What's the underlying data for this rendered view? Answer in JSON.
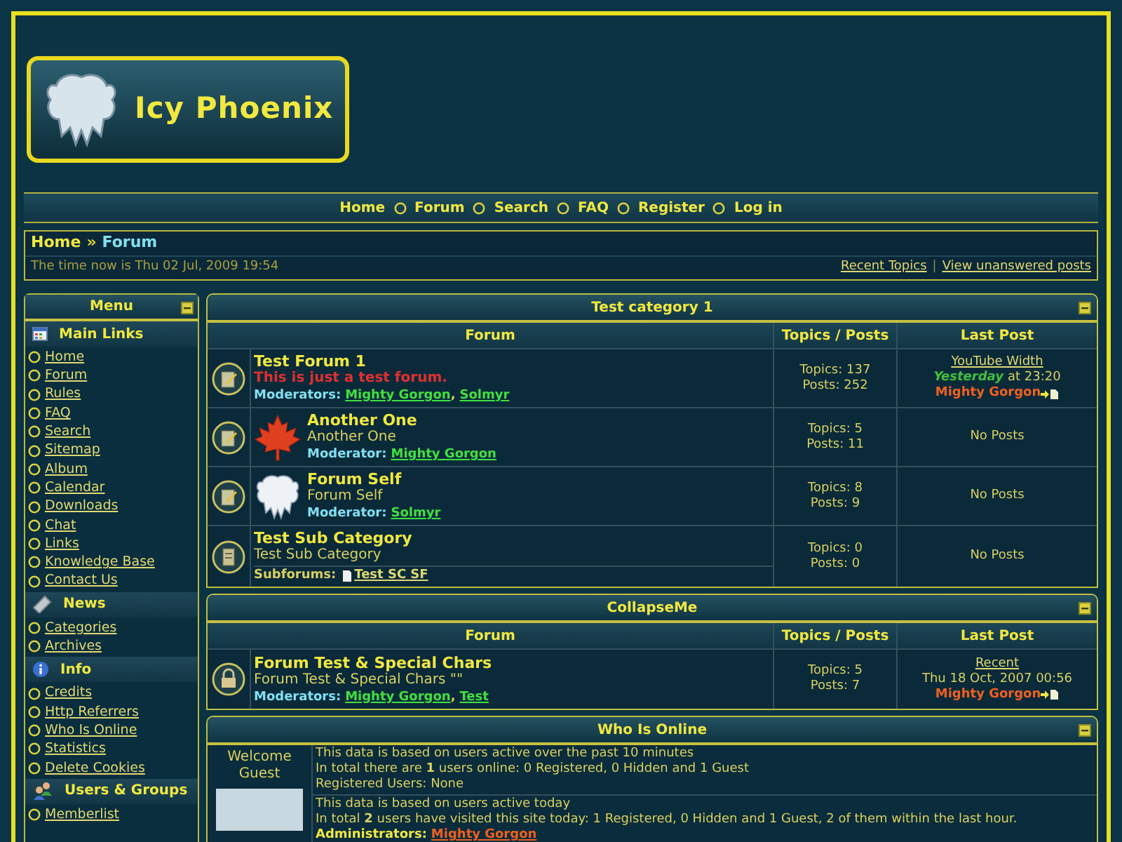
{
  "logo": {
    "text": "Icy Phoenix"
  },
  "nav": [
    {
      "label": "Home"
    },
    {
      "label": "Forum"
    },
    {
      "label": "Search"
    },
    {
      "label": "FAQ"
    },
    {
      "label": "Register"
    },
    {
      "label": "Log in"
    }
  ],
  "breadcrumb": {
    "items": [
      {
        "label": "Home",
        "selected": false
      },
      {
        "label": "Forum",
        "selected": true
      }
    ],
    "separator": "»"
  },
  "time": "The time now is Thu 02 Jul, 2009 19:54",
  "quick_links": {
    "items": [
      "Recent Topics",
      "View unanswered posts"
    ],
    "separator": "|"
  },
  "sidebar": {
    "title": "Menu",
    "sections": [
      {
        "title": "Main Links",
        "links": [
          "Home",
          "Forum",
          "Rules",
          "FAQ",
          "Search",
          "Sitemap",
          "Album",
          "Calendar",
          "Downloads",
          "Chat",
          "Links",
          "Knowledge Base",
          "Contact Us"
        ]
      },
      {
        "title": "News",
        "links": [
          "Categories",
          "Archives"
        ]
      },
      {
        "title": "Info",
        "links": [
          "Credits",
          "Http Referrers",
          "Who Is Online",
          "Statistics",
          "Delete Cookies"
        ]
      },
      {
        "title": "Users & Groups",
        "links": [
          "Memberlist"
        ]
      }
    ]
  },
  "categories": [
    {
      "title": "Test category 1",
      "columns": [
        "Forum",
        "Topics / Posts",
        "Last Post"
      ],
      "forums": [
        {
          "kind": "forum",
          "title": "Test Forum 1",
          "description": "This is just a test forum.",
          "highlight": true,
          "mod_label": "Moderators:",
          "mods": [
            "Mighty Gorgon",
            "Solmyr"
          ],
          "mod_separator": ",",
          "topics": "Topics: 137",
          "posts": "Posts: 252",
          "last_post": {
            "kind": "post",
            "title": "YouTube Width",
            "day": "Yesterday",
            "time": "at 23:20",
            "author": "Mighty Gorgon"
          }
        },
        {
          "kind": "forum",
          "title": "Another One",
          "description": "Another One",
          "highlight": false,
          "mod_label": "Moderator:",
          "mods": [
            "Mighty Gorgon"
          ],
          "topics": "Topics: 5",
          "posts": "Posts: 11",
          "last_post": {
            "kind": "none",
            "text": "No Posts"
          }
        },
        {
          "kind": "forum",
          "title": "Forum Self",
          "description": "Forum Self",
          "highlight": false,
          "mod_label": "Moderator:",
          "mods": [
            "Solmyr"
          ],
          "topics": "Topics: 8",
          "posts": "Posts: 9",
          "last_post": {
            "kind": "none",
            "text": "No Posts"
          }
        },
        {
          "kind": "subcategory",
          "title": "Test Sub Category",
          "description": "Test Sub Category",
          "highlight": false,
          "sub_label": "Subforums:",
          "subforums": [
            "Test SC SF"
          ],
          "topics": "Topics: 0",
          "posts": "Posts: 0",
          "last_post": {
            "kind": "none",
            "text": "No Posts"
          }
        }
      ]
    },
    {
      "title": "CollapseMe",
      "columns": [
        "Forum",
        "Topics / Posts",
        "Last Post"
      ],
      "forums": [
        {
          "kind": "locked",
          "title": "Forum Test & Special Chars",
          "description": "Forum Test & Special Chars \"\"",
          "highlight": false,
          "mod_label": "Moderators:",
          "mods": [
            "Mighty Gorgon",
            "Test"
          ],
          "mod_separator": ",",
          "topics": "Topics: 5",
          "posts": "Posts: 7",
          "last_post": {
            "kind": "post",
            "title": "Recent",
            "time": "Thu 18 Oct, 2007 00:56",
            "author": "Mighty Gorgon"
          }
        }
      ]
    }
  ],
  "who_is_online": {
    "title": "Who Is Online",
    "welcome": [
      "Welcome",
      "Guest"
    ],
    "blocks": [
      {
        "lines": [
          "This data is based on users active over the past 10 minutes",
          "In total there are **1** users online: 0 Registered, 0 Hidden and 1 Guest",
          "Registered Users: None"
        ]
      },
      {
        "lines": [
          "This data is based on users active today",
          "In total **2** users have visited this site today: 1 Registered, 0 Hidden and 1 Guest, 2 of them within the last hour."
        ],
        "admin_label": "Administrators:",
        "admins": [
          "Mighty Gorgon"
        ]
      }
    ]
  }
}
